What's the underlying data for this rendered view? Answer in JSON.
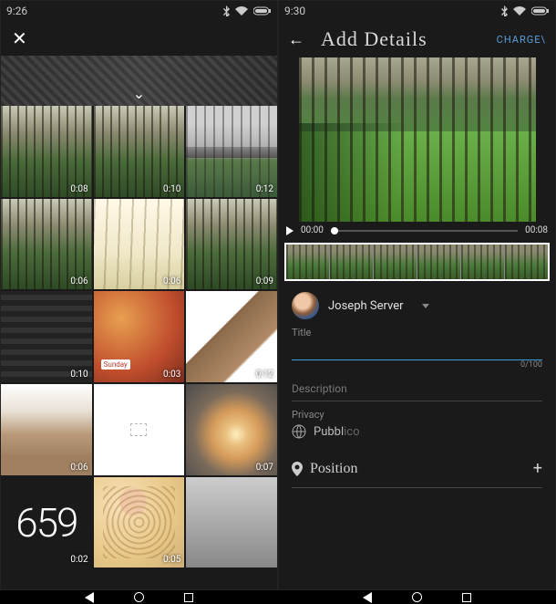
{
  "status": {
    "time_left": "9:26",
    "time_right": "9:30"
  },
  "grid": {
    "cells": [
      {
        "dur": "0:08",
        "cls": "forest"
      },
      {
        "dur": "0:10",
        "cls": "forest"
      },
      {
        "dur": "0:12",
        "cls": "road"
      },
      {
        "dur": "0:06",
        "cls": "forest"
      },
      {
        "dur": "0:06",
        "cls": "bright"
      },
      {
        "dur": "0:09",
        "cls": "forest"
      },
      {
        "dur": "0:10",
        "cls": "kb"
      },
      {
        "dur": "0:03",
        "cls": "food",
        "tag": "Sunday"
      },
      {
        "dur": "0:12",
        "cls": "cat"
      },
      {
        "dur": "0:06",
        "cls": "catcarpet"
      },
      {
        "dur": "",
        "cls": "blank"
      },
      {
        "dur": "0:07",
        "cls": "sunset"
      },
      {
        "dur": "0:02",
        "cls": "digits",
        "text": "659"
      },
      {
        "dur": "0:05",
        "cls": "cookies"
      },
      {
        "dur": "",
        "cls": "last"
      }
    ]
  },
  "details": {
    "back_icon": "arrow-back",
    "title": "Add Details",
    "action": "CHARGE\\",
    "username": "Joseph Server",
    "progress": {
      "current": "00:00",
      "total": "00:08"
    },
    "title_field": {
      "label": "Title",
      "value": "",
      "counter": "0/100"
    },
    "description_field": {
      "label": "Description"
    },
    "privacy": {
      "label": "Privacy",
      "value_dim": "Pubbl",
      "value_rest": "ico"
    },
    "position": {
      "label": "Position"
    }
  }
}
